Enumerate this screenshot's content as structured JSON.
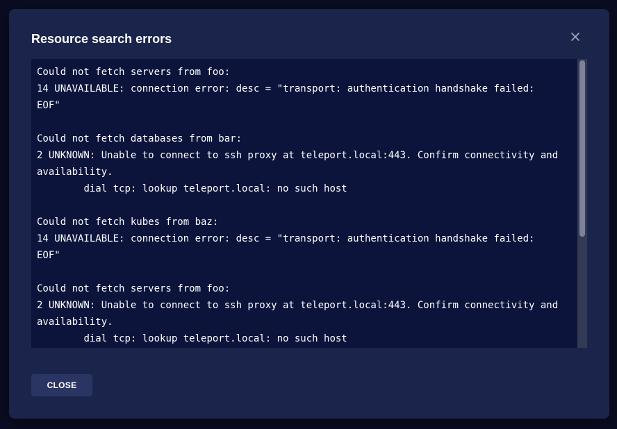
{
  "dialog": {
    "title": "Resource search errors",
    "close_icon": "close-icon",
    "close_button_label": "CLOSE"
  },
  "log": {
    "text": "Could not fetch servers from foo:\n14 UNAVAILABLE: connection error: desc = \"transport: authentication handshake failed:\nEOF\"\n\nCould not fetch databases from bar:\n2 UNKNOWN: Unable to connect to ssh proxy at teleport.local:443. Confirm connectivity and\navailability.\n        dial tcp: lookup teleport.local: no such host\n\nCould not fetch kubes from baz:\n14 UNAVAILABLE: connection error: desc = \"transport: authentication handshake failed:\nEOF\"\n\nCould not fetch servers from foo:\n2 UNKNOWN: Unable to connect to ssh proxy at teleport.local:443. Confirm connectivity and\navailability.\n        dial tcp: lookup teleport.local: no such host"
  },
  "colors": {
    "backdrop": "#0a0d22",
    "dialog_bg": "#1b244a",
    "log_bg": "#0c143c",
    "button_bg": "#2b3563",
    "text": "#ffffff"
  }
}
